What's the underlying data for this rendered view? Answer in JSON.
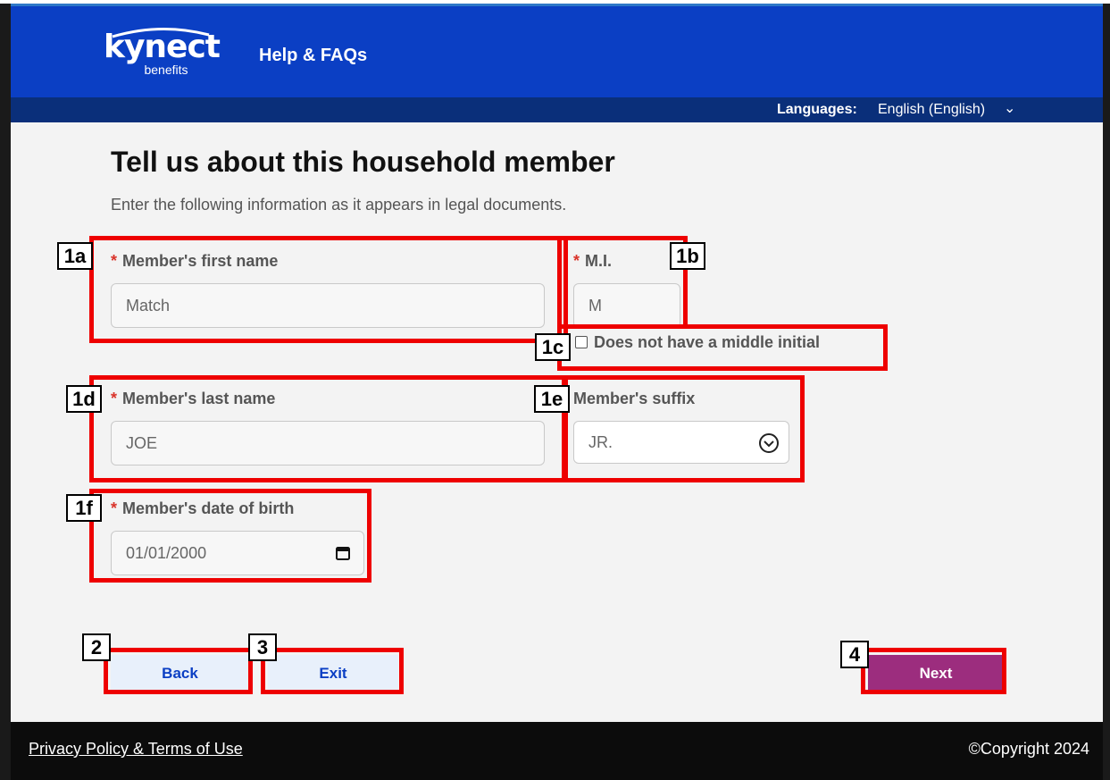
{
  "header": {
    "logo_text": "kynect",
    "logo_subtext": "benefits",
    "help_link": "Help & FAQs",
    "brand_color": "#0b3fc4"
  },
  "language_bar": {
    "label": "Languages:",
    "selected": "English (English)",
    "chevron": "chevron-down-icon"
  },
  "main": {
    "title": "Tell us about this household member",
    "subtitle": "Enter the following information as it appears in legal documents.",
    "fields": {
      "first_name": {
        "required_mark": "*",
        "label": "Member's first name",
        "value": "Match"
      },
      "middle_initial": {
        "required_mark": "*",
        "label": "M.I.",
        "value": "M"
      },
      "no_middle_initial": {
        "label": "Does not have a middle initial",
        "checked": false
      },
      "last_name": {
        "required_mark": "*",
        "label": "Member's last name",
        "value": "JOE"
      },
      "suffix": {
        "label": "Member's suffix",
        "value": "JR.",
        "icon": "chevron-circle-down-icon"
      },
      "dob": {
        "required_mark": "*",
        "label": "Member's date of birth",
        "value": "01/01/2000",
        "icon": "calendar-icon"
      }
    },
    "annotations": [
      "1a",
      "1b",
      "1c",
      "1d",
      "1e",
      "1f",
      "2",
      "3",
      "4"
    ]
  },
  "buttons": {
    "back": "Back",
    "exit": "Exit",
    "next": "Next",
    "next_color": "#9c2d7e",
    "annotation_color": "#ee0000"
  },
  "footer": {
    "link": "Privacy Policy & Terms of Use",
    "copyright": "©Copyright 2024"
  }
}
